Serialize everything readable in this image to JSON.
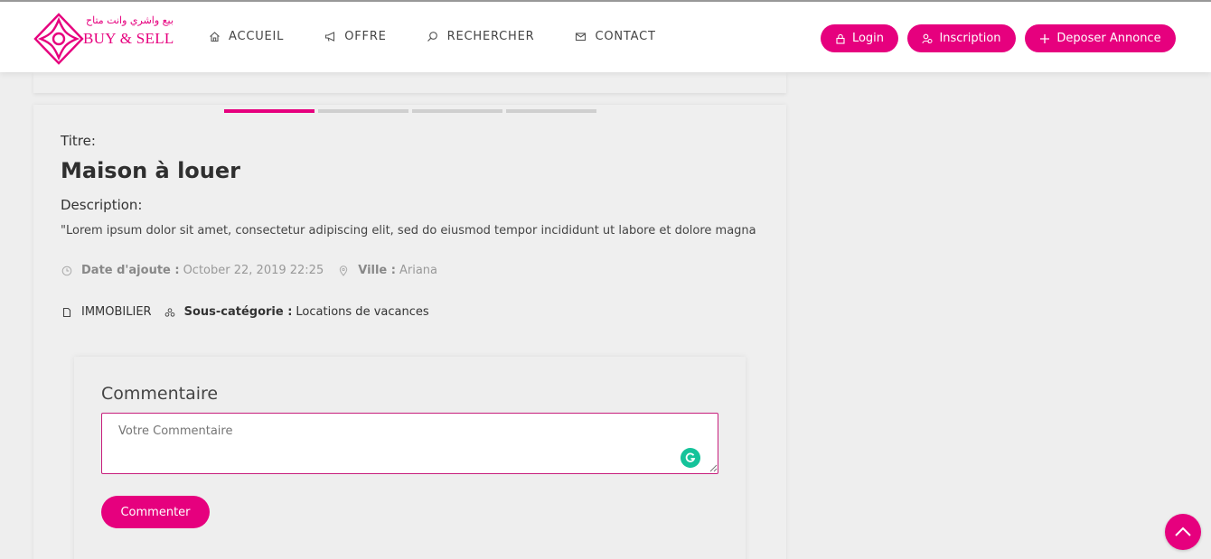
{
  "header": {
    "logo": {
      "arabic_text": "بيع واشري وانت متاح",
      "brand_text": "BUY & SELL"
    },
    "nav": [
      {
        "label": "ACCUEIL",
        "icon": "home-icon"
      },
      {
        "label": "OFFRE",
        "icon": "megaphone-icon"
      },
      {
        "label": "RECHERCHER",
        "icon": "search-icon"
      },
      {
        "label": "CONTACT",
        "icon": "mail-icon"
      }
    ],
    "buttons": {
      "login": "Login",
      "inscription": "Inscription",
      "deposer": "Deposer Annonce"
    }
  },
  "carousel": {
    "slide_count": 4,
    "active_index": 0
  },
  "listing": {
    "title_label": "Titre:",
    "title": "Maison à louer",
    "description_label": "Description:",
    "description": "\"Lorem ipsum dolor sit amet, consectetur adipiscing elit, sed do eiusmod tempor incididunt ut labore et dolore magna",
    "date_label": "Date d'ajoute :",
    "date_value": "October 22, 2019 22:25",
    "city_label": "Ville :",
    "city_value": "Ariana",
    "category": "IMMOBILIER",
    "subcategory_label": "Sous-catégorie :",
    "subcategory_value": "Locations de vacances"
  },
  "comment": {
    "heading": "Commentaire",
    "placeholder": "Votre Commentaire",
    "submit_label": "Commenter"
  },
  "colors": {
    "accent": "#e6007e",
    "background": "#eeeeee",
    "grammarly": "#15c39a"
  }
}
